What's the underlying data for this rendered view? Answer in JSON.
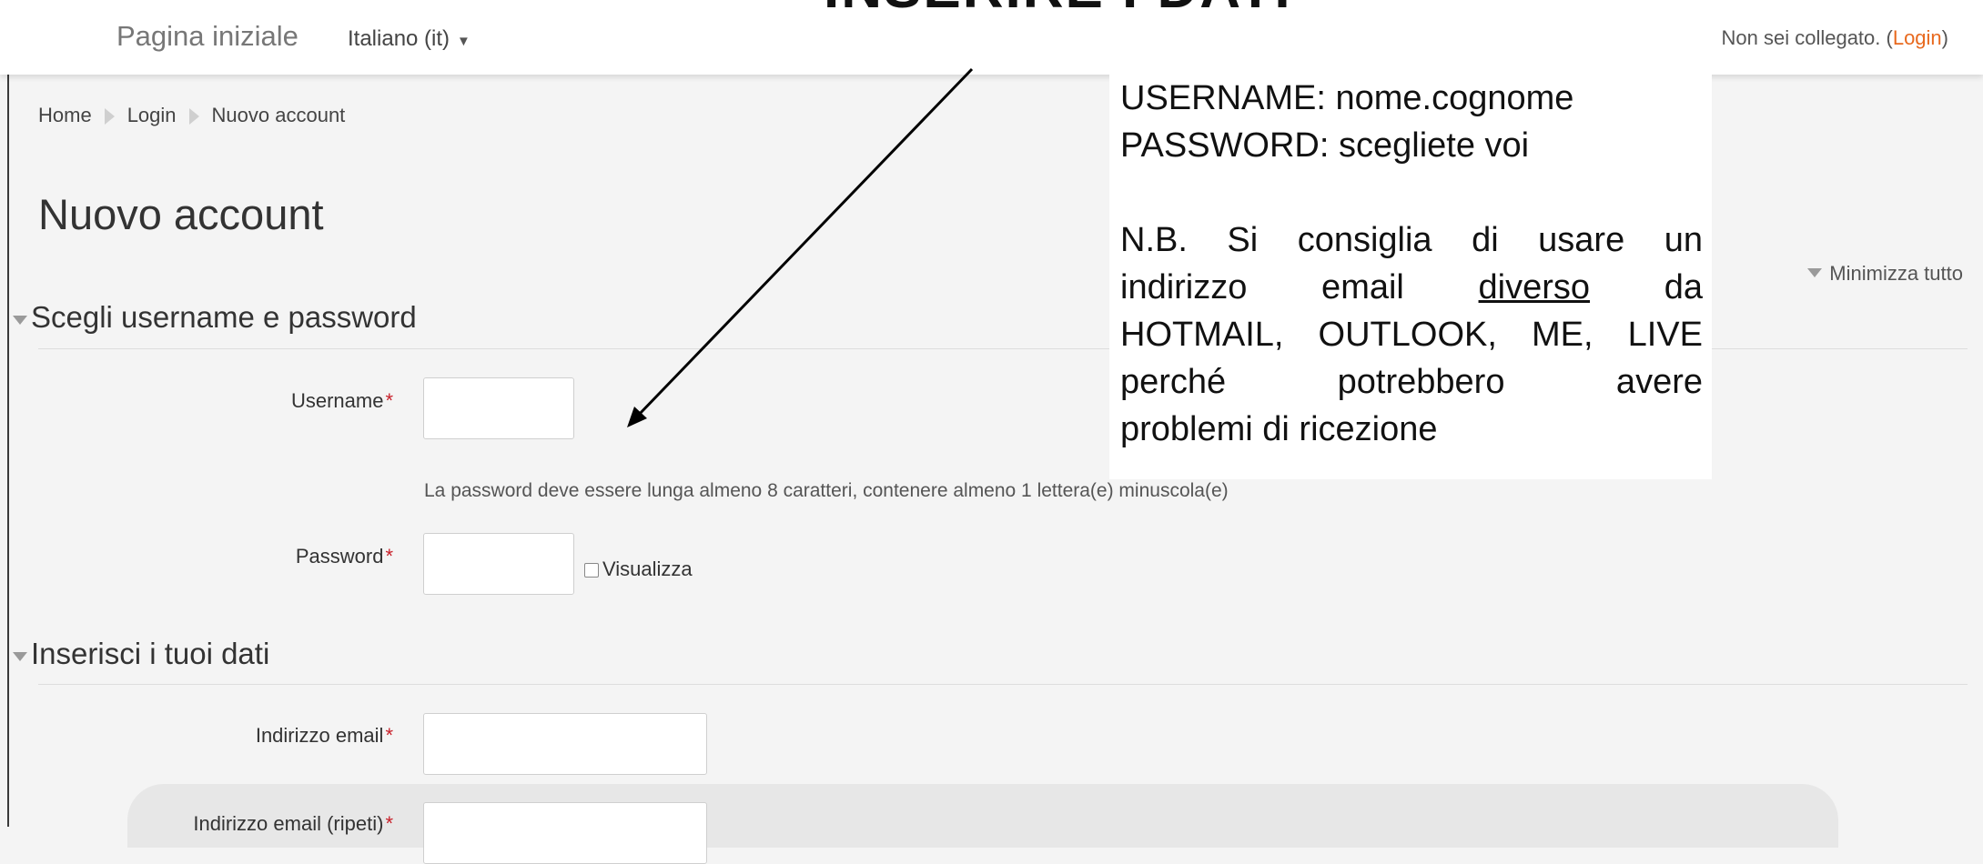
{
  "navbar": {
    "brand": "Pagina iniziale",
    "language": "Italiano (it)",
    "login_status_prefix": "Non sei collegato. (",
    "login_link": "Login",
    "login_status_suffix": ")"
  },
  "overlay_title": "INSERIRE I DATI",
  "breadcrumb": [
    "Home",
    "Login",
    "Nuovo account"
  ],
  "page_title": "Nuovo account",
  "collapse_all": "Minimizza tutto",
  "sections": {
    "credentials": {
      "heading": "Scegli username e password",
      "username_label": "Username",
      "password_help": "La password deve essere lunga almeno 8 caratteri, contenere almeno 1 lettera(e) minuscola(e)",
      "password_label": "Password",
      "show_password_label": "Visualizza"
    },
    "personal": {
      "heading": "Inserisci i tuoi dati",
      "email_label": "Indirizzo email",
      "email_repeat_label": "Indirizzo email (ripeti)"
    }
  },
  "required_marker": "*",
  "note": {
    "line1": "USERNAME: nome.cognome",
    "line2": "PASSWORD: scegliete voi",
    "nb_1": "N.B. Si consiglia di usare un",
    "nb_2a": "indirizzo email ",
    "nb_2u": "diverso",
    "nb_2b": " da",
    "nb_3": "HOTMAIL, OUTLOOK, ME, LIVE",
    "nb_4": "perché potrebbero avere",
    "nb_5": "problemi di ricezione"
  },
  "colors": {
    "accent_link": "#e8691e",
    "required": "#c8202a",
    "background": "#f4f4f4"
  }
}
